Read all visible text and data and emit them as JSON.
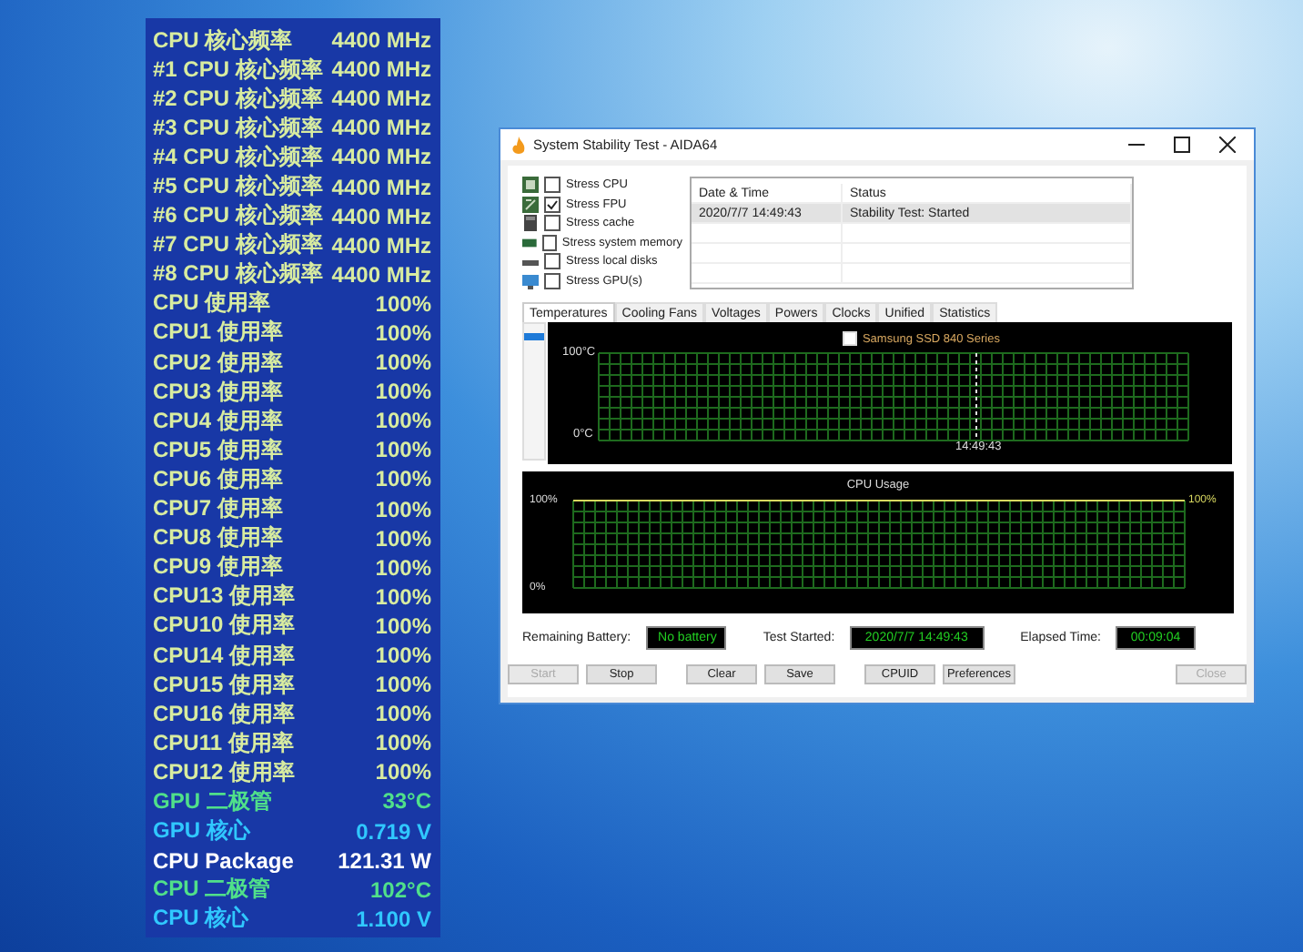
{
  "sensor_panel": {
    "rows": [
      {
        "label": "CPU 核心频率",
        "value": "4400 MHz",
        "color": "#d8eca0"
      },
      {
        "label": "#1 CPU 核心频率",
        "value": "4400 MHz",
        "color": "#d8eca0"
      },
      {
        "label": "#2 CPU 核心频率",
        "value": "4400 MHz",
        "color": "#d8eca0"
      },
      {
        "label": "#3 CPU 核心频率",
        "value": "4400 MHz",
        "color": "#d8eca0"
      },
      {
        "label": "#4 CPU 核心频率",
        "value": "4400 MHz",
        "color": "#d8eca0"
      },
      {
        "label": "#5 CPU 核心频率",
        "value": "4400 MHz",
        "color": "#d8eca0"
      },
      {
        "label": "#6 CPU 核心频率",
        "value": "4400 MHz",
        "color": "#d8eca0"
      },
      {
        "label": "#7 CPU 核心频率",
        "value": "4400 MHz",
        "color": "#d8eca0"
      },
      {
        "label": "#8 CPU 核心频率",
        "value": "4400 MHz",
        "color": "#d8eca0"
      },
      {
        "label": "CPU 使用率",
        "value": "100%",
        "color": "#d8eca0"
      },
      {
        "label": "CPU1 使用率",
        "value": "100%",
        "color": "#d8eca0"
      },
      {
        "label": "CPU2 使用率",
        "value": "100%",
        "color": "#d8eca0"
      },
      {
        "label": "CPU3 使用率",
        "value": "100%",
        "color": "#d8eca0"
      },
      {
        "label": "CPU4 使用率",
        "value": "100%",
        "color": "#d8eca0"
      },
      {
        "label": "CPU5 使用率",
        "value": "100%",
        "color": "#d8eca0"
      },
      {
        "label": "CPU6 使用率",
        "value": "100%",
        "color": "#d8eca0"
      },
      {
        "label": "CPU7 使用率",
        "value": "100%",
        "color": "#d8eca0"
      },
      {
        "label": "CPU8 使用率",
        "value": "100%",
        "color": "#d8eca0"
      },
      {
        "label": "CPU9 使用率",
        "value": "100%",
        "color": "#d8eca0"
      },
      {
        "label": "CPU13 使用率",
        "value": "100%",
        "color": "#d8eca0"
      },
      {
        "label": "CPU10 使用率",
        "value": "100%",
        "color": "#d8eca0"
      },
      {
        "label": "CPU14 使用率",
        "value": "100%",
        "color": "#d8eca0"
      },
      {
        "label": "CPU15 使用率",
        "value": "100%",
        "color": "#d8eca0"
      },
      {
        "label": "CPU16 使用率",
        "value": "100%",
        "color": "#d8eca0"
      },
      {
        "label": "CPU11 使用率",
        "value": "100%",
        "color": "#d8eca0"
      },
      {
        "label": "CPU12 使用率",
        "value": "100%",
        "color": "#d8eca0"
      },
      {
        "label": "GPU 二极管",
        "value": "33°C",
        "color": "#50e08a"
      },
      {
        "label": "GPU 核心",
        "value": "0.719 V",
        "color": "#30c8ff"
      },
      {
        "label": "CPU Package",
        "value": "121.31 W",
        "color": "#ffffff"
      },
      {
        "label": "CPU 二极管",
        "value": "102°C",
        "color": "#50e08a"
      },
      {
        "label": "CPU 核心",
        "value": "1.100 V",
        "color": "#30c8ff"
      }
    ]
  },
  "window": {
    "title": "System Stability Test - AIDA64",
    "stress_options": [
      {
        "label": "Stress CPU",
        "checked": false,
        "kind": "cpu"
      },
      {
        "label": "Stress FPU",
        "checked": true,
        "kind": "fpu"
      },
      {
        "label": "Stress cache",
        "checked": false,
        "kind": "cache"
      },
      {
        "label": "Stress system memory",
        "checked": false,
        "kind": "memory"
      },
      {
        "label": "Stress local disks",
        "checked": false,
        "kind": "disk"
      },
      {
        "label": "Stress GPU(s)",
        "checked": false,
        "kind": "gpu"
      }
    ],
    "log_table": {
      "columns": [
        "Date & Time",
        "Status"
      ],
      "rows": [
        {
          "cells": [
            "2020/7/7 14:49:43",
            "Stability Test: Started"
          ],
          "selected": true
        }
      ]
    },
    "tabs": [
      {
        "label": "Temperatures",
        "selected": true
      },
      {
        "label": "Cooling Fans",
        "selected": false
      },
      {
        "label": "Voltages",
        "selected": false
      },
      {
        "label": "Powers",
        "selected": false
      },
      {
        "label": "Clocks",
        "selected": false
      },
      {
        "label": "Unified",
        "selected": false
      },
      {
        "label": "Statistics",
        "selected": false
      }
    ],
    "temperature_graph": {
      "legend": {
        "label": "Samsung SSD 840 Series",
        "checked": false
      },
      "y_top": "100°C",
      "y_bottom": "0°C",
      "time_marker": "14:49:43"
    },
    "cpu_usage_graph": {
      "chart_data": {
        "type": "line",
        "title": "CPU Usage",
        "ylim": [
          0,
          100
        ],
        "yticks": [
          {
            "value": 0,
            "label": "0%"
          },
          {
            "value": 100,
            "label": "100%"
          }
        ],
        "grid": true,
        "series": [
          {
            "color": "#d8d860",
            "values": [
              100,
              100,
              100,
              100,
              100,
              100,
              100,
              100,
              100,
              100,
              100,
              100
            ]
          }
        ],
        "annotations": [
          {
            "text": "100%"
          }
        ]
      }
    },
    "status": [
      {
        "label": "Remaining Battery:",
        "value": "No battery"
      },
      {
        "label": "Test Started:",
        "value": "2020/7/7 14:49:43"
      },
      {
        "label": "Elapsed Time:",
        "value": "00:09:04"
      }
    ],
    "buttons": [
      {
        "label": "Start",
        "disabled": true
      },
      {
        "label": "Stop",
        "disabled": false
      },
      {
        "label": "Clear",
        "disabled": false
      },
      {
        "label": "Save",
        "disabled": false
      },
      {
        "label": "CPUID",
        "disabled": false
      },
      {
        "label": "Preferences",
        "disabled": false
      },
      {
        "label": "Close",
        "disabled": true
      }
    ]
  }
}
